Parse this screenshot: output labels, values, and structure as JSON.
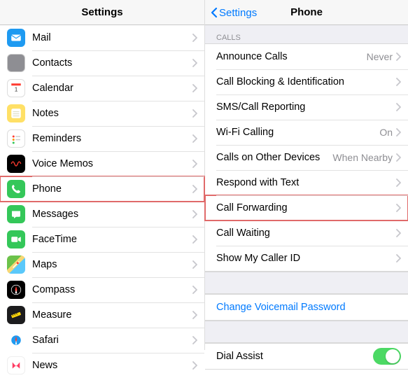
{
  "left": {
    "title": "Settings",
    "items": [
      {
        "id": "mail",
        "label": "Mail",
        "iconBg": "#1e9af1",
        "glyph": "mail"
      },
      {
        "id": "contacts",
        "label": "Contacts",
        "iconBg": "#8e8e93",
        "glyph": "contacts"
      },
      {
        "id": "calendar",
        "label": "Calendar",
        "iconBg": "#ffffff",
        "glyph": "calendar"
      },
      {
        "id": "notes",
        "label": "Notes",
        "iconBg": "#ffe066",
        "glyph": "notes"
      },
      {
        "id": "reminders",
        "label": "Reminders",
        "iconBg": "#ffffff",
        "glyph": "reminders"
      },
      {
        "id": "voicememos",
        "label": "Voice Memos",
        "iconBg": "#000000",
        "glyph": "voicememos"
      },
      {
        "id": "phone",
        "label": "Phone",
        "iconBg": "#34c759",
        "glyph": "phone",
        "highlighted": true
      },
      {
        "id": "messages",
        "label": "Messages",
        "iconBg": "#34c759",
        "glyph": "messages"
      },
      {
        "id": "facetime",
        "label": "FaceTime",
        "iconBg": "#34c759",
        "glyph": "facetime"
      },
      {
        "id": "maps",
        "label": "Maps",
        "iconBg": "#6cc24a",
        "glyph": "maps"
      },
      {
        "id": "compass",
        "label": "Compass",
        "iconBg": "#000000",
        "glyph": "compass"
      },
      {
        "id": "measure",
        "label": "Measure",
        "iconBg": "#1c1c1e",
        "glyph": "measure"
      },
      {
        "id": "safari",
        "label": "Safari",
        "iconBg": "#1e9af1",
        "glyph": "safari"
      },
      {
        "id": "news",
        "label": "News",
        "iconBg": "#ffffff",
        "glyph": "news"
      }
    ]
  },
  "right": {
    "backLabel": "Settings",
    "title": "Phone",
    "sections": [
      {
        "header": "CALLS",
        "rows": [
          {
            "id": "announce",
            "label": "Announce Calls",
            "value": "Never",
            "chevron": true
          },
          {
            "id": "blocking",
            "label": "Call Blocking & Identification",
            "value": "",
            "chevron": true
          },
          {
            "id": "smsreport",
            "label": "SMS/Call Reporting",
            "value": "",
            "chevron": true
          },
          {
            "id": "wificall",
            "label": "Wi-Fi Calling",
            "value": "On",
            "chevron": true
          },
          {
            "id": "otherdev",
            "label": "Calls on Other Devices",
            "value": "When Nearby",
            "chevron": true
          },
          {
            "id": "respond",
            "label": "Respond with Text",
            "value": "",
            "chevron": true
          },
          {
            "id": "forwarding",
            "label": "Call Forwarding",
            "value": "",
            "chevron": true,
            "highlighted": true
          },
          {
            "id": "waiting",
            "label": "Call Waiting",
            "value": "",
            "chevron": true
          },
          {
            "id": "callerid",
            "label": "Show My Caller ID",
            "value": "",
            "chevron": true
          }
        ]
      },
      {
        "header": "",
        "rows": [
          {
            "id": "changevm",
            "label": "Change Voicemail Password",
            "link": true
          }
        ]
      },
      {
        "header": "",
        "rows": [
          {
            "id": "dialassist",
            "label": "Dial Assist",
            "toggle": true,
            "toggleOn": true
          }
        ]
      }
    ]
  }
}
